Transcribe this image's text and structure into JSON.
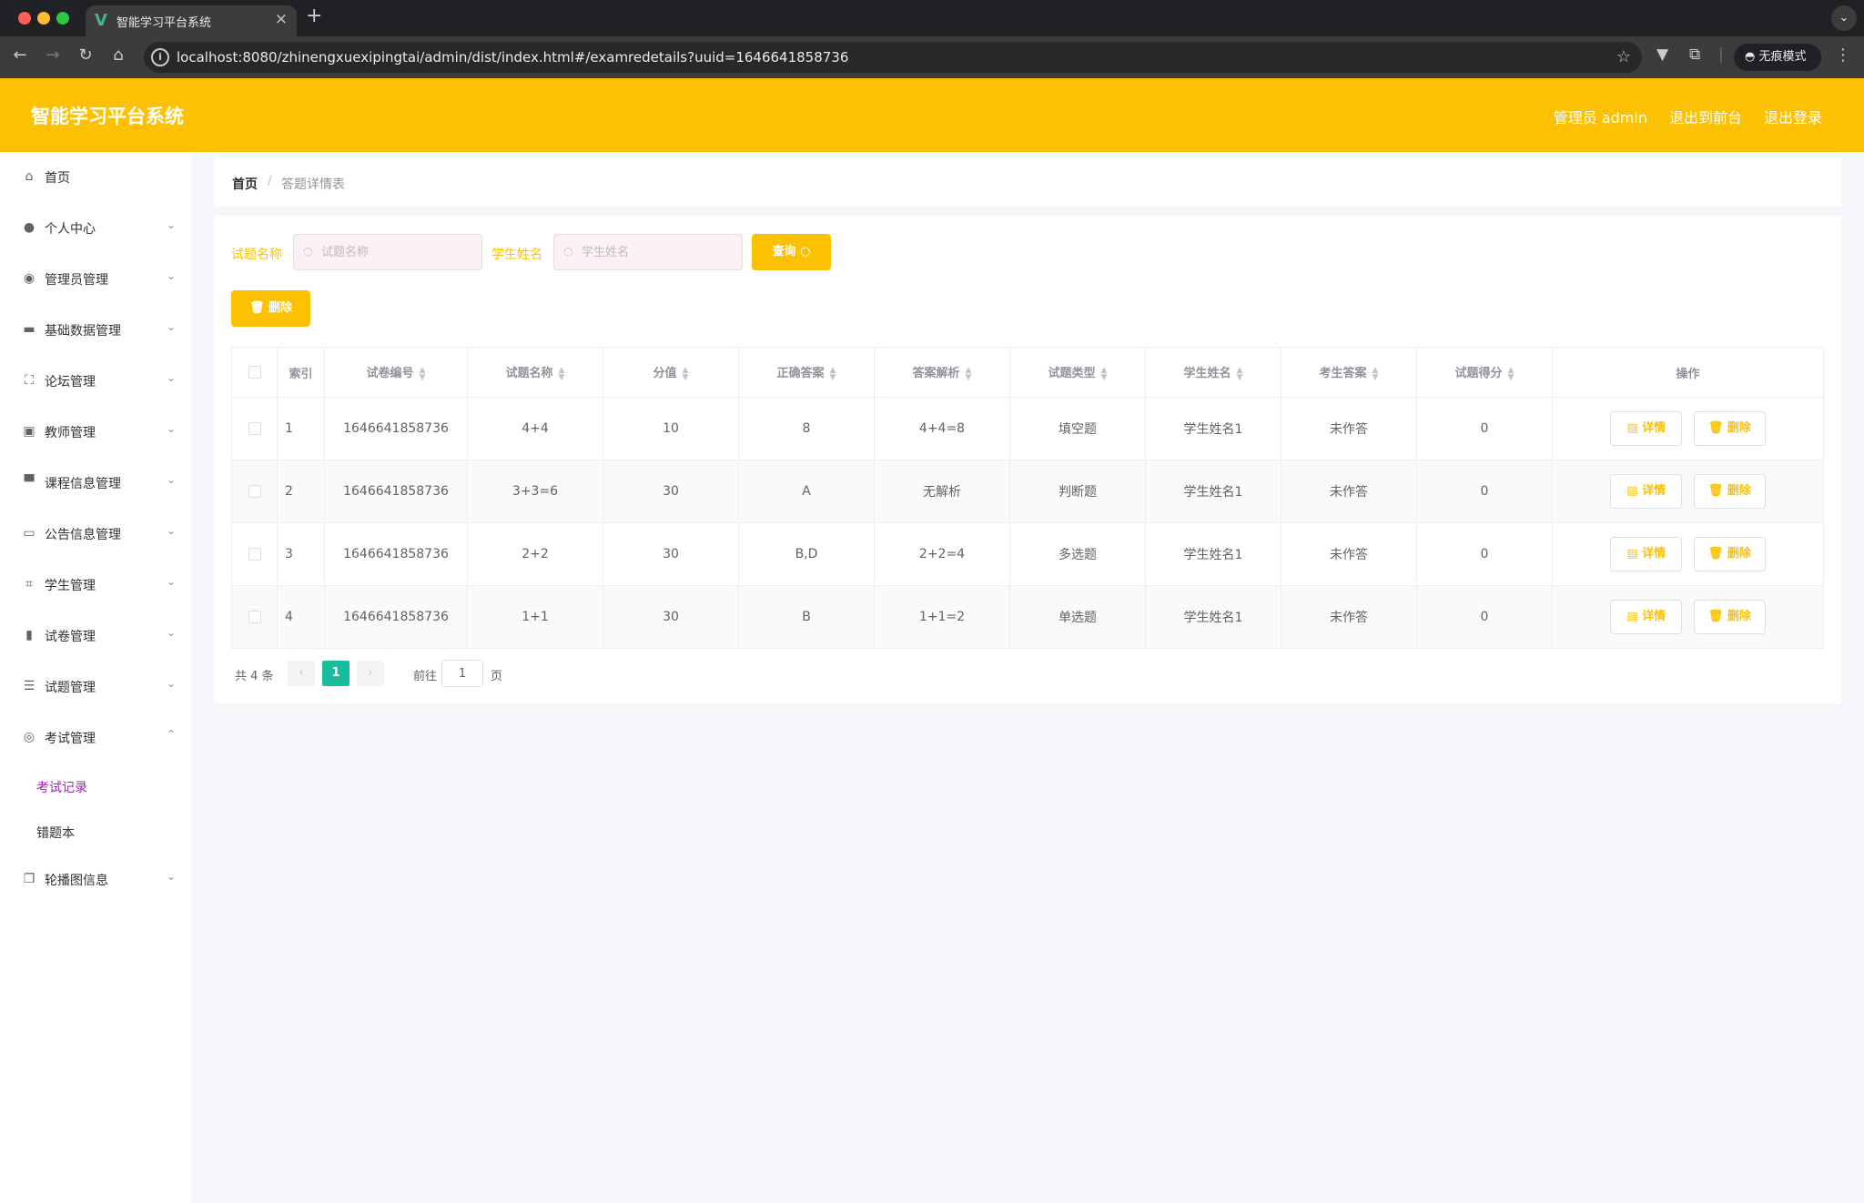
{
  "browser": {
    "tab_title": "智能学习平台系统",
    "url": "localhost:8080/zhinengxuexipingtai/admin/dist/index.html#/examredetails?uuid=1646641858736",
    "incognito_label": "无痕模式"
  },
  "header": {
    "title": "智能学习平台系统",
    "admin_label": "管理员 admin",
    "front_link": "退出到前台",
    "logout_link": "退出登录",
    "color": "#fbc102"
  },
  "sidebar": {
    "items": [
      {
        "label": "首页",
        "icon": "home-icon"
      },
      {
        "label": "个人中心",
        "icon": "user-icon"
      },
      {
        "label": "管理员管理",
        "icon": "pin-icon"
      },
      {
        "label": "基础数据管理",
        "icon": "ticket-icon"
      },
      {
        "label": "论坛管理",
        "icon": "frame-icon"
      },
      {
        "label": "教师管理",
        "icon": "clipboard-icon"
      },
      {
        "label": "课程信息管理",
        "icon": "board-icon"
      },
      {
        "label": "公告信息管理",
        "icon": "card-icon"
      },
      {
        "label": "学生管理",
        "icon": "crop-icon"
      },
      {
        "label": "试卷管理",
        "icon": "bar-chart-icon"
      },
      {
        "label": "试题管理",
        "icon": "list-icon"
      },
      {
        "label": "考试管理",
        "icon": "compass-icon"
      },
      {
        "label": "轮播图信息",
        "icon": "copy-icon"
      }
    ],
    "sub_items": [
      {
        "label": "考试记录",
        "active": true
      },
      {
        "label": "错题本",
        "active": false
      }
    ],
    "active_color": "#9c27b0"
  },
  "breadcrumb": {
    "home": "首页",
    "separator": "/",
    "current": "答题详情表"
  },
  "search": {
    "field1_label": "试题名称",
    "field1_placeholder": "试题名称",
    "field2_label": "学生姓名",
    "field2_placeholder": "学生姓名",
    "query_label": "查询",
    "delete_label": "删除"
  },
  "table": {
    "headers": [
      "索引",
      "试卷编号",
      "试题名称",
      "分值",
      "正确答案",
      "答案解析",
      "试题类型",
      "学生姓名",
      "考生答案",
      "试题得分",
      "操作"
    ],
    "rows": [
      {
        "index": "1",
        "paper_no": "1646641858736",
        "name": "4+4",
        "score": "10",
        "answer": "8",
        "analysis": "4+4=8",
        "type": "填空题",
        "student": "学生姓名1",
        "student_answer": "未作答",
        "got": "0"
      },
      {
        "index": "2",
        "paper_no": "1646641858736",
        "name": "3+3=6",
        "score": "30",
        "answer": "A",
        "analysis": "无解析",
        "type": "判断题",
        "student": "学生姓名1",
        "student_answer": "未作答",
        "got": "0"
      },
      {
        "index": "3",
        "paper_no": "1646641858736",
        "name": "2+2",
        "score": "30",
        "answer": "B,D",
        "analysis": "2+2=4",
        "type": "多选题",
        "student": "学生姓名1",
        "student_answer": "未作答",
        "got": "0"
      },
      {
        "index": "4",
        "paper_no": "1646641858736",
        "name": "1+1",
        "score": "30",
        "answer": "B",
        "analysis": "1+1=2",
        "type": "单选题",
        "student": "学生姓名1",
        "student_answer": "未作答",
        "got": "0"
      }
    ],
    "detail_label": "详情",
    "delete_label": "删除"
  },
  "pagination": {
    "total": "共 4 条",
    "current": "1",
    "goto_label": "前往",
    "goto_value": "1",
    "page_unit": "页"
  }
}
